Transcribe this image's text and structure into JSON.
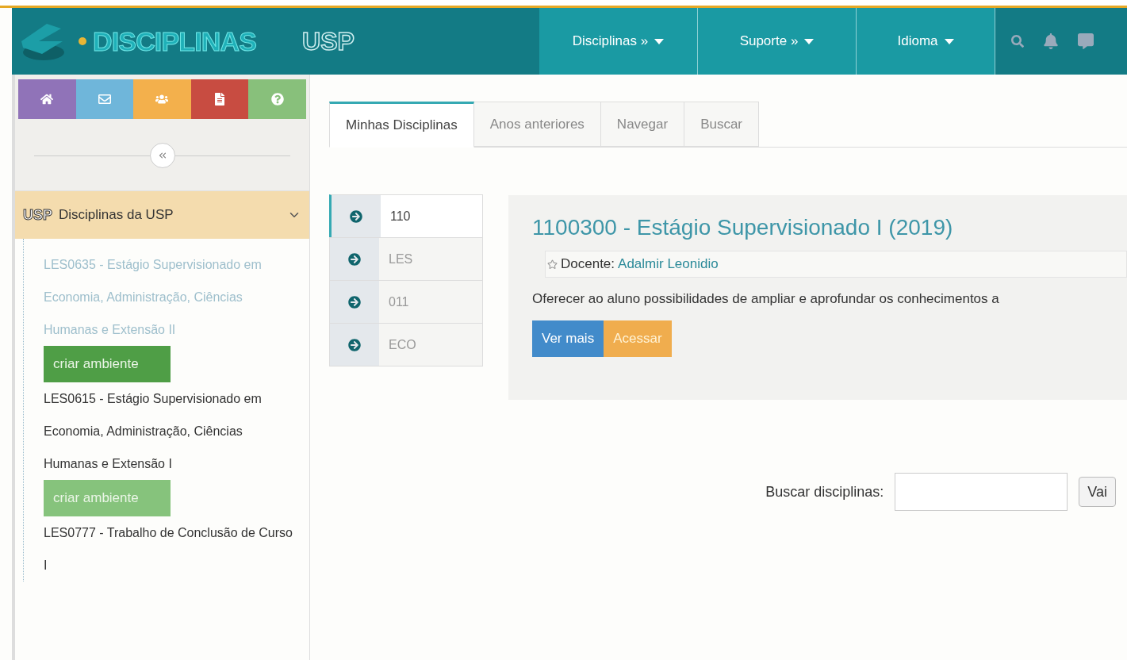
{
  "header": {
    "logo_text": "DISCIPLINAS",
    "brand": "USP",
    "nav": [
      {
        "label": "Disciplinas »"
      },
      {
        "label": "Suporte »"
      },
      {
        "label": "Idioma"
      }
    ]
  },
  "sidebar": {
    "section": {
      "brand": "USP",
      "title": "Disciplinas da USP",
      "expanded": true
    },
    "courses": [
      {
        "title": "LES0635 - Estágio Supervisionado em Economia, Administração, Ciências Humanas e Extensão II",
        "dimmed": true,
        "button": "criar ambiente",
        "hovered": true
      },
      {
        "title": "LES0615 - Estágio Supervisionado em Economia, Administração, Ciências Humanas e Extensão I",
        "dimmed": false,
        "button": "criar ambiente",
        "hovered": false
      },
      {
        "title": "LES0777 - Trabalho de Conclusão de Curso I",
        "dimmed": false
      }
    ]
  },
  "tabs": [
    {
      "label": "Minhas Disciplinas",
      "selected": true
    },
    {
      "label": "Anos anteriores",
      "selected": false
    },
    {
      "label": "Navegar",
      "selected": false
    },
    {
      "label": "Buscar",
      "selected": false
    }
  ],
  "filters": [
    {
      "label": "110",
      "selected": true
    },
    {
      "label": "LES",
      "selected": false
    },
    {
      "label": "011",
      "selected": false
    },
    {
      "label": "ECO",
      "selected": false
    }
  ],
  "course_card": {
    "title": "1100300 - Estágio Supervisionado I (2019)",
    "docente_label": "Docente:",
    "docente": "Adalmir Leonidio",
    "description": "Oferecer ao aluno possibilidades de ampliar e aprofundar os conhecimentos a",
    "buttons": [
      {
        "kind": "info",
        "label": "Ver mais"
      },
      {
        "kind": "warning",
        "label": "Acessar"
      }
    ]
  },
  "search": {
    "label": "Buscar disciplinas:",
    "button": "Vai"
  }
}
